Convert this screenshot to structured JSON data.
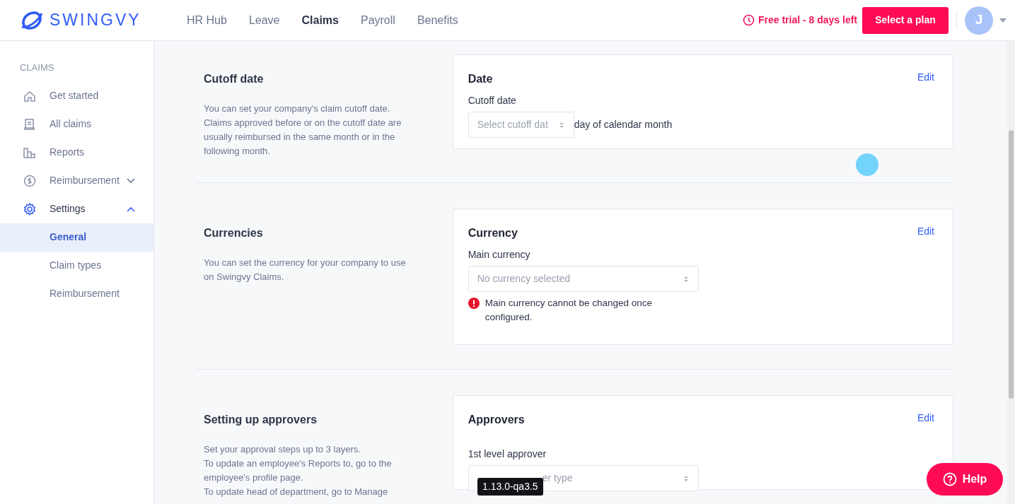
{
  "brand": {
    "name": "SWINGVY"
  },
  "nav": [
    {
      "label": "HR Hub",
      "selected": false
    },
    {
      "label": "Leave",
      "selected": false
    },
    {
      "label": "Claims",
      "selected": true
    },
    {
      "label": "Payroll",
      "selected": false
    },
    {
      "label": "Benefits",
      "selected": false
    }
  ],
  "trial": {
    "text": "Free trial - 8 days left"
  },
  "plan_button": "Select a plan",
  "avatar": {
    "initial": "J"
  },
  "sidebar": {
    "heading": "CLAIMS",
    "items": [
      {
        "label": "Get started",
        "selected": false
      },
      {
        "label": "All claims",
        "selected": false
      },
      {
        "label": "Reports",
        "selected": false
      },
      {
        "label": "Reimbursement",
        "selected": false,
        "expanded": false
      },
      {
        "label": "Settings",
        "selected": false,
        "expanded": true,
        "children": [
          {
            "label": "General",
            "selected": true
          },
          {
            "label": "Claim types",
            "selected": false
          },
          {
            "label": "Reimbursement",
            "selected": false
          }
        ]
      }
    ]
  },
  "sections": [
    {
      "title": "Cutoff date",
      "description": [
        "You can set your company's claim cutoff date. Claims approved before or on the cutoff date are usually reimbursed in the same month or in the following month."
      ],
      "card": {
        "title": "Date",
        "edit": "Edit",
        "field_label": "Cutoff date",
        "kind": "inline",
        "placeholder": "Select cutoff dat",
        "suffix": "day of calendar month"
      }
    },
    {
      "title": "Currencies",
      "description": [
        "You can set the currency for your company to use on Swingvy Claims."
      ],
      "card": {
        "title": "Currency",
        "edit": "Edit",
        "field_label": "Main currency",
        "kind": "wide",
        "placeholder": "No currency selected",
        "error": "Main currency cannot be changed once configured."
      }
    },
    {
      "title": "Setting up approvers",
      "description": [
        "Set your approval steps up to 3 layers.",
        "To update an employee's Reports to, go to the employee's profile page.",
        "To update head of department, go to Manage"
      ],
      "card": {
        "title": "Approvers",
        "edit": "Edit",
        "field_label": "1st level approver",
        "kind": "wide",
        "placeholder": "er type"
      }
    }
  ],
  "tooltip": "1.13.0-qa3.5",
  "help_button": "Help"
}
